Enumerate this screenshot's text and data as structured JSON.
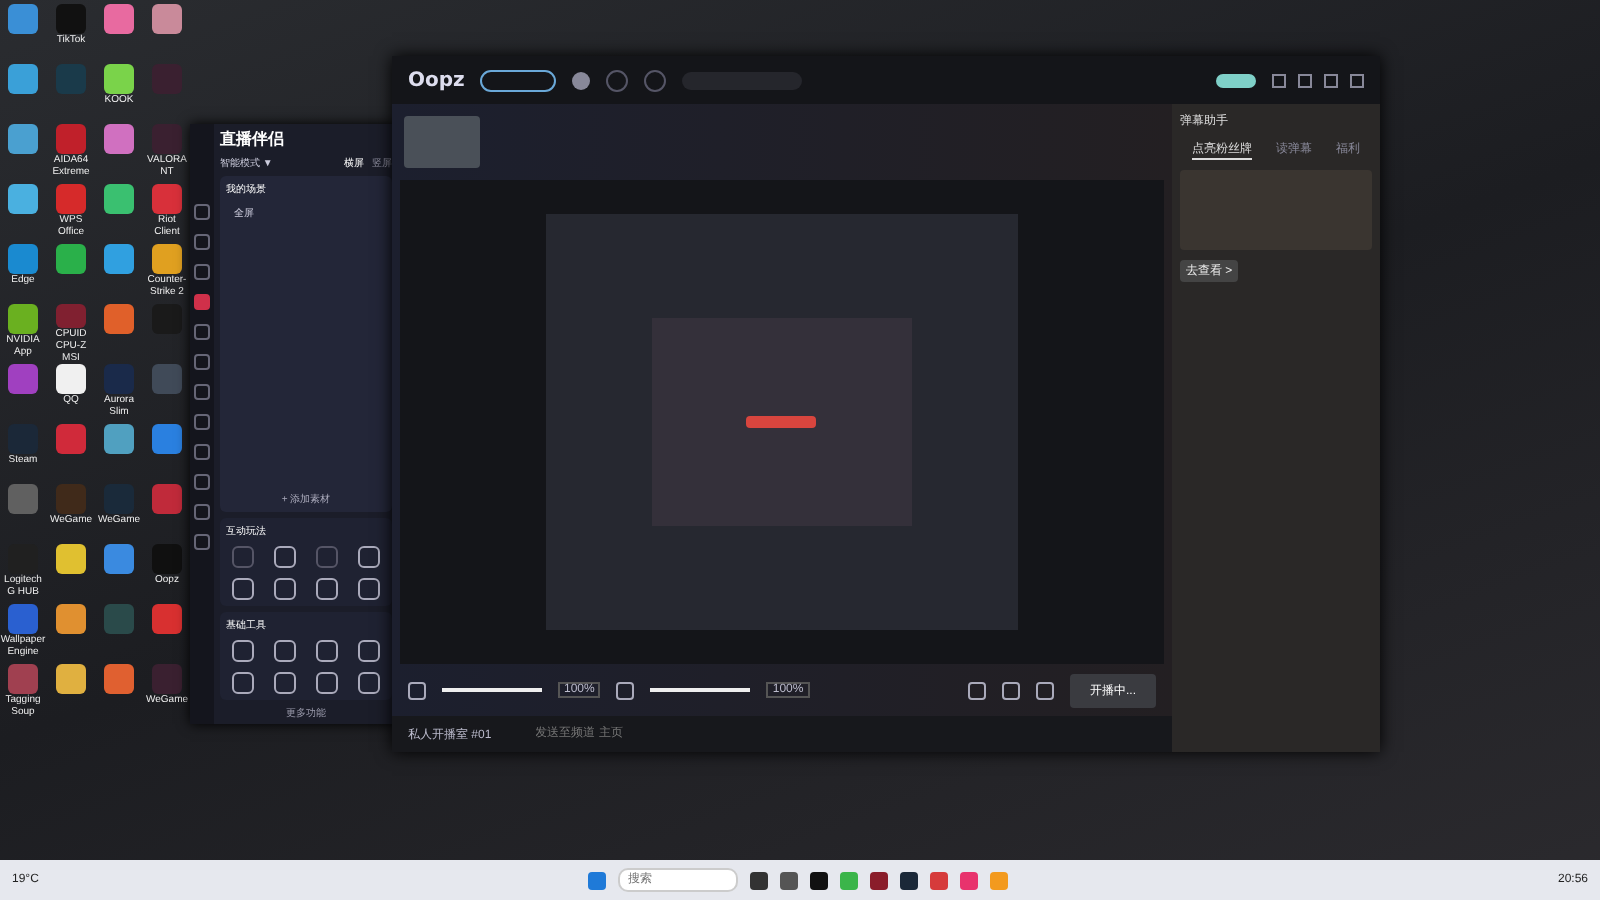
{
  "desktop_icons": [
    {
      "color": "#3a8fd6"
    },
    {
      "label": "TikTok",
      "color": "#111111"
    },
    {
      "color": "#e86aa0"
    },
    {
      "color": "#c98a9a"
    },
    {
      "color": "#3aa0d8"
    },
    {
      "color": "#1a3a4a"
    },
    {
      "label": "KOOK",
      "color": "#7ad34a"
    },
    {
      "color": "#3a2030"
    },
    {
      "color": "#4aa0d0"
    },
    {
      "label": "AIDA64 Extreme",
      "color": "#c0202a"
    },
    {
      "color": "#d070c0"
    },
    {
      "label": "VALORANT",
      "color": "#3a2030"
    },
    {
      "color": "#4ab0e0"
    },
    {
      "label": "WPS Office",
      "color": "#d62a2a"
    },
    {
      "color": "#3ac070"
    },
    {
      "label": "Riot Client",
      "color": "#d8303a"
    },
    {
      "label": "Edge",
      "color": "#1a8ad0"
    },
    {
      "color": "#2ab04a"
    },
    {
      "color": "#30a0e0"
    },
    {
      "label": "Counter-Strike 2",
      "color": "#e0a020"
    },
    {
      "label": "NVIDIA App",
      "color": "#6ab020"
    },
    {
      "label": "CPUID CPU-Z MSI",
      "color": "#802030"
    },
    {
      "color": "#e0602a"
    },
    {
      "color": "#1a1a1a"
    },
    {
      "color": "#a040c0"
    },
    {
      "label": "QQ",
      "color": "#f0f0f0"
    },
    {
      "label": "Aurora Slim",
      "color": "#1a2a4a"
    },
    {
      "color": "#404a58"
    },
    {
      "label": "Steam",
      "color": "#1b2838"
    },
    {
      "color": "#d02a3a"
    },
    {
      "color": "#50a0c0"
    },
    {
      "color": "#2a80e0"
    },
    {
      "color": "#606060"
    },
    {
      "label": "WeGame",
      "color": "#402a1a"
    },
    {
      "label": "WeGame",
      "color": "#1a2a3a"
    },
    {
      "color": "#c02a3a"
    },
    {
      "label": "Logitech G HUB",
      "color": "#202020"
    },
    {
      "color": "#e0c030"
    },
    {
      "color": "#3a8ae0"
    },
    {
      "label": "Oopz",
      "color": "#101010"
    },
    {
      "label": "Wallpaper Engine",
      "color": "#2a60d0"
    },
    {
      "color": "#e09030"
    },
    {
      "color": "#2a4a4a"
    },
    {
      "color": "#d83030"
    },
    {
      "label": "Tagging Soup",
      "color": "#a04050"
    },
    {
      "color": "#e0b040"
    },
    {
      "color": "#e06030"
    },
    {
      "label": "WeGame",
      "color": "#3a2030"
    }
  ],
  "streaming_app": {
    "title": "直播伴侣",
    "mode": "智能模式 ▼",
    "orientation_tabs": [
      {
        "label": "横屏",
        "selected": true
      },
      {
        "label": "竖屏",
        "selected": false
      }
    ],
    "scene_tab": "我的场景",
    "source": "全屏",
    "add_source": "+ 添加素材",
    "sections": [
      {
        "title": "互动玩法",
        "tools": [
          {
            "disabled": true
          },
          {
            "disabled": false
          },
          {
            "disabled": true
          },
          {
            "disabled": false
          },
          {
            "disabled": false
          },
          {
            "disabled": false
          },
          {
            "disabled": false
          },
          {
            "disabled": false
          }
        ]
      },
      {
        "title": "基础工具",
        "tools": [
          {
            "disabled": false
          },
          {
            "disabled": false
          },
          {
            "disabled": false
          },
          {
            "disabled": false
          },
          {
            "disabled": false
          },
          {
            "disabled": false
          },
          {
            "disabled": false
          },
          {
            "disabled": false
          }
        ]
      }
    ],
    "more": "更多功能"
  },
  "oopz": {
    "logo": "Oopz",
    "stream_controls": [
      {
        "level": 1,
        "reading": "100%"
      },
      {
        "level": 1,
        "reading": "100%"
      }
    ],
    "start_button": "开播中...",
    "chat": {
      "room": "私人开播室 #01",
      "placeholder": "发送至频道 主页"
    },
    "side_panel": {
      "title": "弹幕助手",
      "tabs": [
        {
          "label": "点亮粉丝牌",
          "selected": true
        },
        {
          "label": "读弹幕",
          "selected": false
        },
        {
          "label": "福利",
          "selected": false
        }
      ],
      "more_button": "去查看 >"
    }
  },
  "taskbar": {
    "temperature": "19°C",
    "search_placeholder": "搜索",
    "time": "20:56"
  }
}
